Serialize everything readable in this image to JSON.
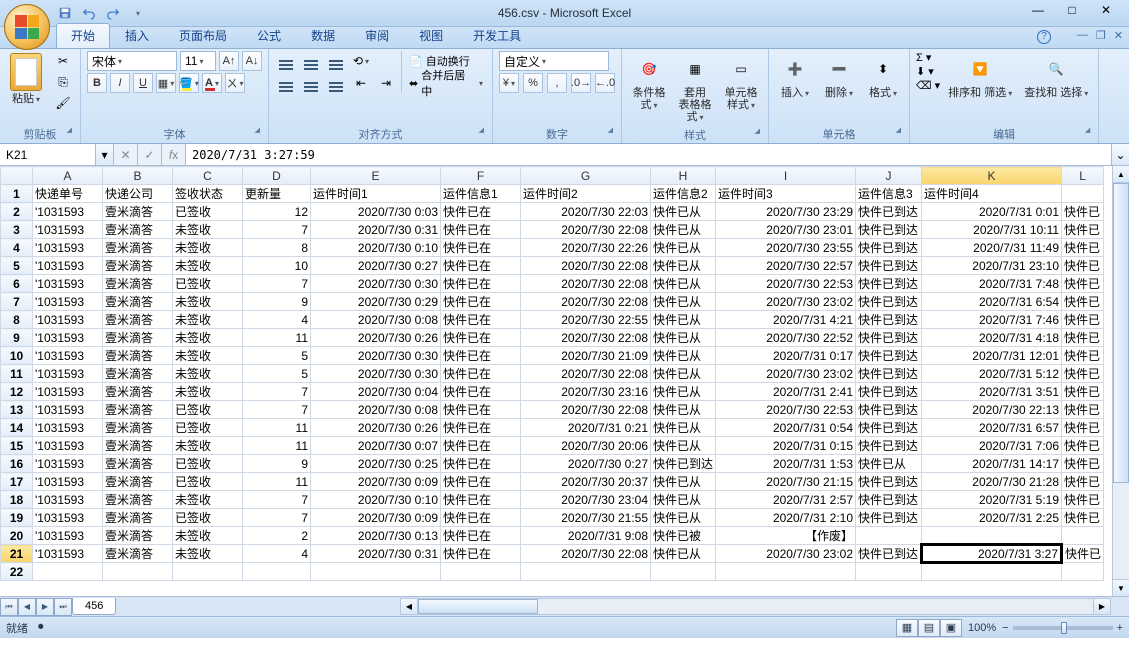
{
  "title": "456.csv - Microsoft Excel",
  "tabs": [
    "开始",
    "插入",
    "页面布局",
    "公式",
    "数据",
    "审阅",
    "视图",
    "开发工具"
  ],
  "activeTab": 0,
  "ribbon": {
    "clipboard": {
      "label": "剪贴板",
      "paste": "粘贴"
    },
    "font": {
      "label": "字体",
      "name": "宋体",
      "size": "11"
    },
    "align": {
      "label": "对齐方式",
      "wrap": "自动换行",
      "merge": "合并后居中"
    },
    "number": {
      "label": "数字",
      "format": "自定义"
    },
    "styles": {
      "label": "样式",
      "cond": "条件格式",
      "table": "套用\n表格格式",
      "cell": "单元格\n样式"
    },
    "cells": {
      "label": "单元格",
      "insert": "插入",
      "delete": "删除",
      "format": "格式"
    },
    "editing": {
      "label": "编辑",
      "sort": "排序和\n筛选",
      "find": "查找和\n选择"
    }
  },
  "nameBox": "K21",
  "formula": "2020/7/31  3:27:59",
  "columns": [
    "A",
    "B",
    "C",
    "D",
    "E",
    "F",
    "G",
    "H",
    "I",
    "J",
    "K",
    "L"
  ],
  "headers": {
    "A": "快递单号",
    "B": "快递公司",
    "C": "签收状态",
    "D": "更新量",
    "E": "运件时间1",
    "F": "运件信息1",
    "G": "运件时间2",
    "H": "运件信息2",
    "I": "运件时间3",
    "J": "运件信息3",
    "K": "运件时间4",
    "L": ""
  },
  "selected": {
    "row": 21,
    "col": "K"
  },
  "rows": [
    {
      "n": 2,
      "A": "'1031593",
      "B": "壹米滴答",
      "C": "已签收",
      "D": "12",
      "E": "2020/7/30 0:03",
      "F": "快件已在",
      "G": "2020/7/30 22:03",
      "H": "快件已从",
      "I": "2020/7/30 23:29",
      "J": "快件已到达",
      "K": "2020/7/31 0:01",
      "L": "快件已"
    },
    {
      "n": 3,
      "A": "'1031593",
      "B": "壹米滴答",
      "C": "未签收",
      "D": "7",
      "E": "2020/7/30 0:31",
      "F": "快件已在",
      "G": "2020/7/30 22:08",
      "H": "快件已从",
      "I": "2020/7/30 23:01",
      "J": "快件已到达",
      "K": "2020/7/31 10:11",
      "L": "快件已"
    },
    {
      "n": 4,
      "A": "'1031593",
      "B": "壹米滴答",
      "C": "未签收",
      "D": "8",
      "E": "2020/7/30 0:10",
      "F": "快件已在",
      "G": "2020/7/30 22:26",
      "H": "快件已从",
      "I": "2020/7/30 23:55",
      "J": "快件已到达",
      "K": "2020/7/31 11:49",
      "L": "快件已"
    },
    {
      "n": 5,
      "A": "'1031593",
      "B": "壹米滴答",
      "C": "未签收",
      "D": "10",
      "E": "2020/7/30 0:27",
      "F": "快件已在",
      "G": "2020/7/30 22:08",
      "H": "快件已从",
      "I": "2020/7/30 22:57",
      "J": "快件已到达",
      "K": "2020/7/31 23:10",
      "L": "快件已"
    },
    {
      "n": 6,
      "A": "'1031593",
      "B": "壹米滴答",
      "C": "已签收",
      "D": "7",
      "E": "2020/7/30 0:30",
      "F": "快件已在",
      "G": "2020/7/30 22:08",
      "H": "快件已从",
      "I": "2020/7/30 22:53",
      "J": "快件已到达",
      "K": "2020/7/31 7:48",
      "L": "快件已"
    },
    {
      "n": 7,
      "A": "'1031593",
      "B": "壹米滴答",
      "C": "未签收",
      "D": "9",
      "E": "2020/7/30 0:29",
      "F": "快件已在",
      "G": "2020/7/30 22:08",
      "H": "快件已从",
      "I": "2020/7/30 23:02",
      "J": "快件已到达",
      "K": "2020/7/31 6:54",
      "L": "快件已"
    },
    {
      "n": 8,
      "A": "'1031593",
      "B": "壹米滴答",
      "C": "未签收",
      "D": "4",
      "E": "2020/7/30 0:08",
      "F": "快件已在",
      "G": "2020/7/30 22:55",
      "H": "快件已从",
      "I": "2020/7/31 4:21",
      "J": "快件已到达",
      "K": "2020/7/31 7:46",
      "L": "快件已"
    },
    {
      "n": 9,
      "A": "'1031593",
      "B": "壹米滴答",
      "C": "未签收",
      "D": "11",
      "E": "2020/7/30 0:26",
      "F": "快件已在",
      "G": "2020/7/30 22:08",
      "H": "快件已从",
      "I": "2020/7/30 22:52",
      "J": "快件已到达",
      "K": "2020/7/31 4:18",
      "L": "快件已"
    },
    {
      "n": 10,
      "A": "'1031593",
      "B": "壹米滴答",
      "C": "未签收",
      "D": "5",
      "E": "2020/7/30 0:30",
      "F": "快件已在",
      "G": "2020/7/30 21:09",
      "H": "快件已从",
      "I": "2020/7/31 0:17",
      "J": "快件已到达",
      "K": "2020/7/31 12:01",
      "L": "快件已"
    },
    {
      "n": 11,
      "A": "'1031593",
      "B": "壹米滴答",
      "C": "未签收",
      "D": "5",
      "E": "2020/7/30 0:30",
      "F": "快件已在",
      "G": "2020/7/30 22:08",
      "H": "快件已从",
      "I": "2020/7/30 23:02",
      "J": "快件已到达",
      "K": "2020/7/31 5:12",
      "L": "快件已"
    },
    {
      "n": 12,
      "A": "'1031593",
      "B": "壹米滴答",
      "C": "未签收",
      "D": "7",
      "E": "2020/7/30 0:04",
      "F": "快件已在",
      "G": "2020/7/30 23:16",
      "H": "快件已从",
      "I": "2020/7/31 2:41",
      "J": "快件已到达",
      "K": "2020/7/31 3:51",
      "L": "快件已"
    },
    {
      "n": 13,
      "A": "'1031593",
      "B": "壹米滴答",
      "C": "已签收",
      "D": "7",
      "E": "2020/7/30 0:08",
      "F": "快件已在",
      "G": "2020/7/30 22:08",
      "H": "快件已从",
      "I": "2020/7/30 22:53",
      "J": "快件已到达",
      "K": "2020/7/30 22:13",
      "L": "快件已"
    },
    {
      "n": 14,
      "A": "'1031593",
      "B": "壹米滴答",
      "C": "已签收",
      "D": "11",
      "E": "2020/7/30 0:26",
      "F": "快件已在",
      "G": "2020/7/31 0:21",
      "H": "快件已从",
      "I": "2020/7/31 0:54",
      "J": "快件已到达",
      "K": "2020/7/31 6:57",
      "L": "快件已"
    },
    {
      "n": 15,
      "A": "'1031593",
      "B": "壹米滴答",
      "C": "未签收",
      "D": "11",
      "E": "2020/7/30 0:07",
      "F": "快件已在",
      "G": "2020/7/30 20:06",
      "H": "快件已从",
      "I": "2020/7/31 0:15",
      "J": "快件已到达",
      "K": "2020/7/31 7:06",
      "L": "快件已"
    },
    {
      "n": 16,
      "A": "'1031593",
      "B": "壹米滴答",
      "C": "已签收",
      "D": "9",
      "E": "2020/7/30 0:25",
      "F": "快件已在",
      "G": "2020/7/30 0:27",
      "H": "快件已到达",
      "I": "2020/7/31 1:53",
      "J": "快件已从",
      "K": "2020/7/31 14:17",
      "L": "快件已"
    },
    {
      "n": 17,
      "A": "'1031593",
      "B": "壹米滴答",
      "C": "已签收",
      "D": "11",
      "E": "2020/7/30 0:09",
      "F": "快件已在",
      "G": "2020/7/30 20:37",
      "H": "快件已从",
      "I": "2020/7/30 21:15",
      "J": "快件已到达",
      "K": "2020/7/30 21:28",
      "L": "快件已"
    },
    {
      "n": 18,
      "A": "'1031593",
      "B": "壹米滴答",
      "C": "未签收",
      "D": "7",
      "E": "2020/7/30 0:10",
      "F": "快件已在",
      "G": "2020/7/30 23:04",
      "H": "快件已从",
      "I": "2020/7/31 2:57",
      "J": "快件已到达",
      "K": "2020/7/31 5:19",
      "L": "快件已"
    },
    {
      "n": 19,
      "A": "'1031593",
      "B": "壹米滴答",
      "C": "已签收",
      "D": "7",
      "E": "2020/7/30 0:09",
      "F": "快件已在",
      "G": "2020/7/30 21:55",
      "H": "快件已从",
      "I": "2020/7/31 2:10",
      "J": "快件已到达",
      "K": "2020/7/31 2:25",
      "L": "快件已"
    },
    {
      "n": 20,
      "A": "'1031593",
      "B": "壹米滴答",
      "C": "未签收",
      "D": "2",
      "E": "2020/7/30 0:13",
      "F": "快件已在",
      "G": "2020/7/31 9:08",
      "H": "快件已被",
      "I": "【作废】",
      "J": "",
      "K": "",
      "L": ""
    },
    {
      "n": 21,
      "A": "'1031593",
      "B": "壹米滴答",
      "C": "未签收",
      "D": "4",
      "E": "2020/7/30 0:31",
      "F": "快件已在",
      "G": "2020/7/30 22:08",
      "H": "快件已从",
      "I": "2020/7/30 23:02",
      "J": "快件已到达",
      "K": "2020/7/31 3:27",
      "L": "快件已"
    }
  ],
  "sheetTab": "456",
  "status": "就绪",
  "zoom": "100%"
}
